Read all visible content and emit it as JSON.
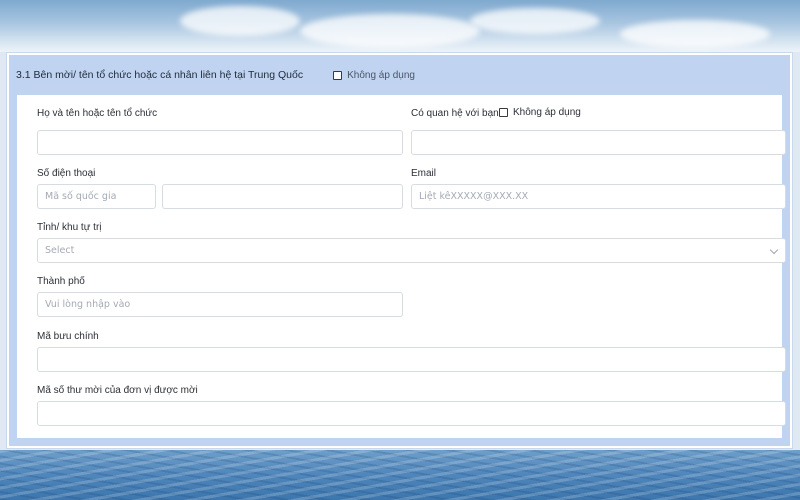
{
  "section": {
    "title": "3.1 Bên mời/ tên tổ chức hoặc cá nhân liên hệ tại Trung Quốc",
    "not_applicable_label": "Không áp dụng"
  },
  "form": {
    "name_label": "Họ và tên hoặc tên tổ chức",
    "name_value": "",
    "relation_label": "Có quan hệ với bạn",
    "relation_not_applicable_label": "Không áp dụng",
    "relation_value": "",
    "phone_label": "Số điện thoại",
    "country_code_placeholder": "Mã số quốc gia",
    "phone_value": "",
    "email_label": "Email",
    "email_placeholder": "Liệt kêXXXXX@XXX.XX",
    "province_label": "Tỉnh/ khu tự trị",
    "province_selected": "Select",
    "city_label": "Thành phố",
    "city_placeholder": "Vui lòng nhập vào",
    "postal_label": "Mã bưu chính",
    "postal_value": "",
    "invitation_label": "Mã số thư mời của đơn vị được mời",
    "invitation_value": ""
  }
}
